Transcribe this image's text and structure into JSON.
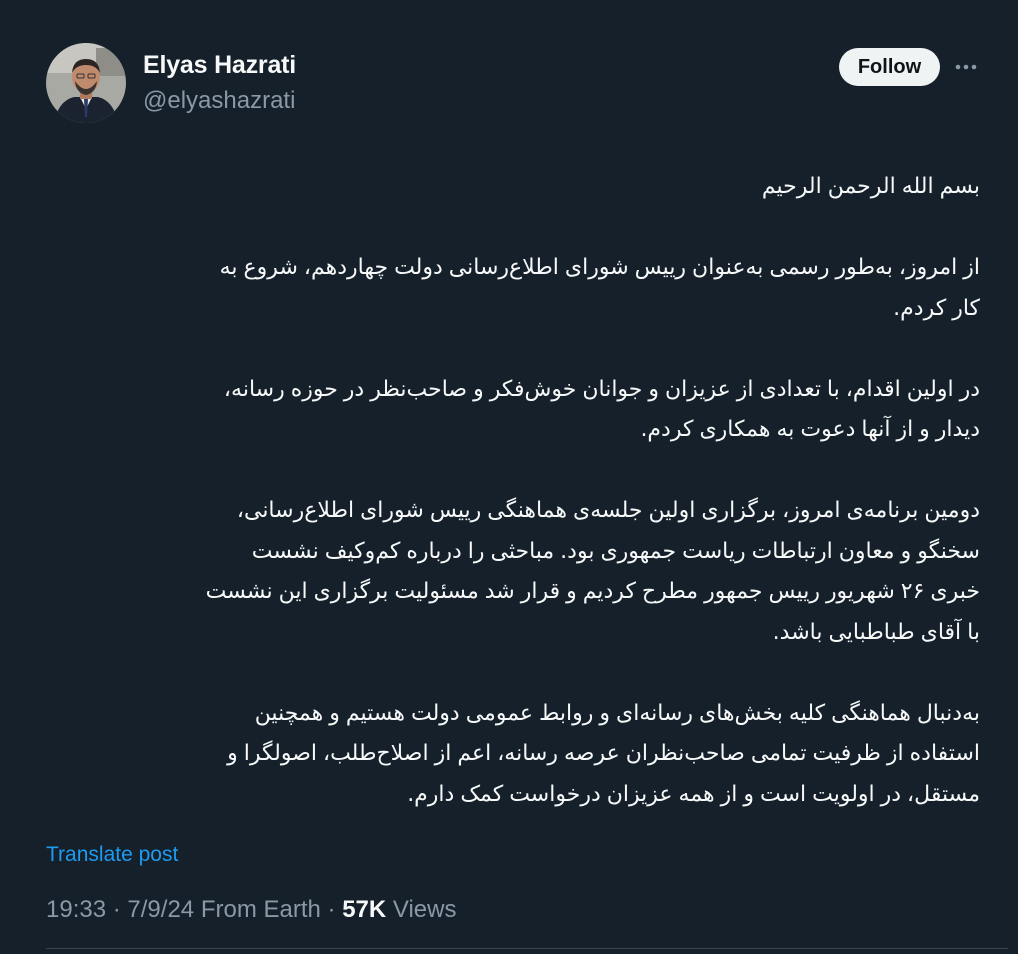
{
  "author": {
    "name": "Elyas Hazrati",
    "handle": "@elyashazrati"
  },
  "actions": {
    "follow_label": "Follow",
    "more_icon": "more-horizontal-icon"
  },
  "post": {
    "paragraphs": [
      [
        "بسم الله الرحمن الرحیم"
      ],
      [
        "از امروز، به‌طور رسمی به‌عنوان رییس شورای اطلاع‌رسانی دولت چهاردهم، شروع به",
        "کار کردم."
      ],
      [
        "در اولین اقدام، با تعدادی از عزیزان و جوانان خوش‌فکر و صاحب‌نظر در حوزه رسانه،",
        "دیدار و از آنها دعوت به همکاری کردم."
      ],
      [
        "دومین برنامه‌ی امروز، برگزاری اولین جلسه‌ی هماهنگی رییس شورای اطلاع‌رسانی،",
        "سخنگو و معاون ارتباطات ریاست جمهوری بود. مباحثی را درباره کم‌وکیف نشست",
        "خبری ۲۶ شهریور رییس جمهور مطرح کردیم و قرار شد مسئولیت برگزاری این نشست",
        "با آقای طباطبایی باشد."
      ],
      [
        "به‌دنبال هماهنگی کلیه بخش‌های رسانه‌ای و روابط عمومی دولت هستیم و همچنین",
        "استفاده از ظرفیت تمامی صاحب‌نظران عرصه رسانه، اعم از اصلاح‌طلب، اصولگرا و",
        "مستقل، در اولویت است و از همه عزیزان درخواست کمک دارم."
      ]
    ],
    "translate_label": "Translate post",
    "time": "19:33",
    "date": "7/9/24",
    "source": "From Earth",
    "separator": "·",
    "views_count": "57K",
    "views_label": "Views"
  },
  "colors": {
    "background": "#15202b",
    "text": "#f7f9f9",
    "secondary": "#8b98a5",
    "link": "#1d9bf0",
    "button_bg": "#eff3f4"
  }
}
